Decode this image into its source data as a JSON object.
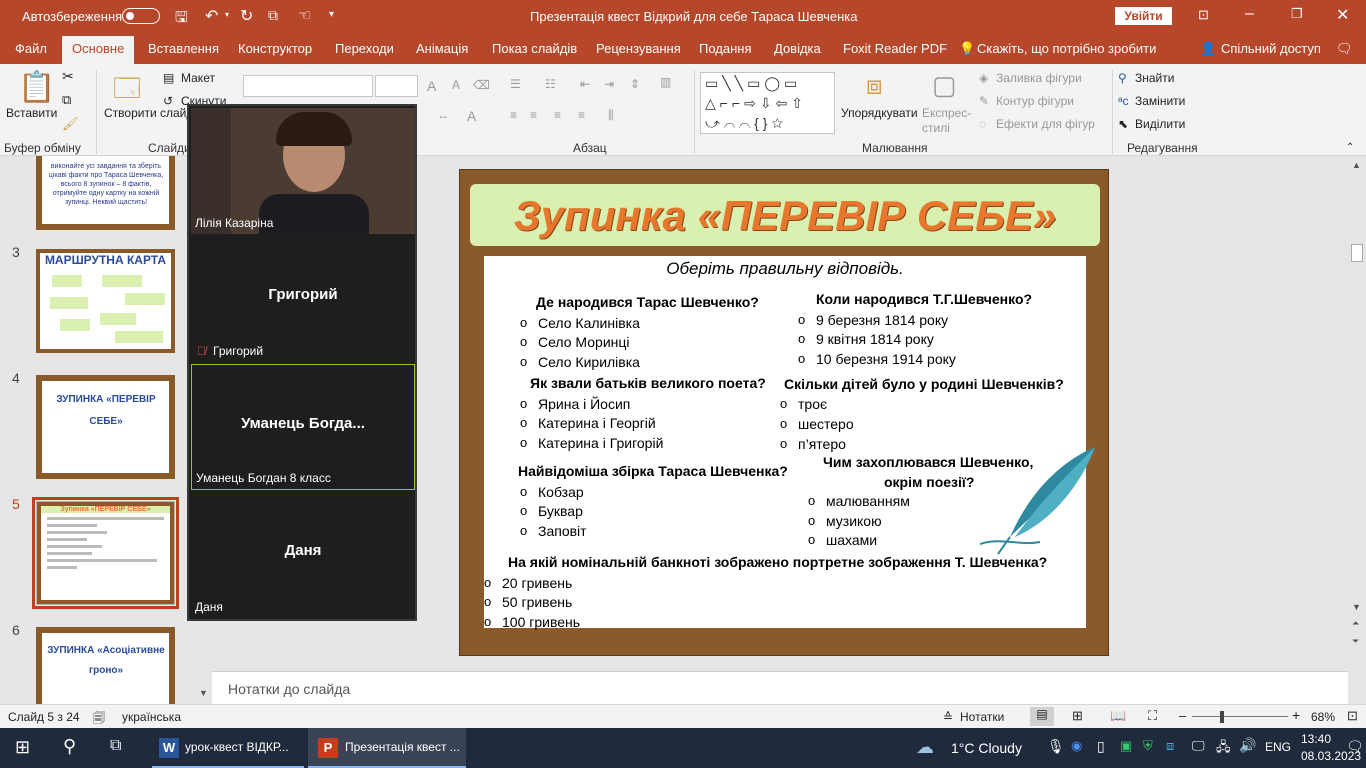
{
  "titlebar": {
    "autosave_label": "Автозбереження",
    "autosave_state": "off",
    "title": "Презентація квест Відкрий для себе Тараса Шевченка",
    "signin_label": "Увійти",
    "icons": [
      "save-icon",
      "undo-icon",
      "redo-icon",
      "present-icon",
      "touch-icon",
      "customize-icon"
    ]
  },
  "menu": {
    "tabs": [
      "Файл",
      "Основне",
      "Вставлення",
      "Конструктор",
      "Переходи",
      "Анімація",
      "Показ слайдів",
      "Рецензування",
      "Подання",
      "Довідка",
      "Foxit Reader PDF"
    ],
    "active_tab": "Основне",
    "tell_me": "Скажіть, що потрібно зробити",
    "share": "Спільний доступ"
  },
  "ribbon": {
    "paste": "Вставити",
    "clipboard_group": "Буфер обміну",
    "new_slide": "Створити слайд",
    "layout": "Макет",
    "reset": "Скинути",
    "slides_group": "Слайди",
    "paragraph_group": "Абзац",
    "arrange": "Упорядкувати",
    "quick_styles": "Експрес-стилі",
    "shape_fill": "Заливка фігури",
    "shape_outline": "Контур фігури",
    "shape_effects": "Ефекти для фігур",
    "drawing_group": "Малювання",
    "find": "Знайти",
    "replace": "Замінити",
    "select": "Виділити",
    "editing_group": "Редагування"
  },
  "thumbnails": [
    {
      "num": "",
      "caption": "виконайте усі завдання та зберіть цікаві факти про Тараса Шевченка, всього 8 зупинок – 8 фактів, отримуйте одну картку на кожній зупинці. Неквий щастить!"
    },
    {
      "num": "3",
      "caption": "МАРШРУТНА КАРТА"
    },
    {
      "num": "4",
      "caption": "ЗУПИНКА «ПЕРЕВІР СЕБЕ»"
    },
    {
      "num": "5",
      "caption": "Зупинка «ПЕРЕВІР СЕБЕ»"
    },
    {
      "num": "6",
      "caption": "ЗУПИНКА «Асоціативне гроно»"
    }
  ],
  "selected_thumbnail": "5",
  "zoom_panel": {
    "participants": [
      {
        "name": "Лілія Казаріна",
        "video": true
      },
      {
        "name": "Григорий",
        "display": "Григорий",
        "muted": true
      },
      {
        "name": "Уманець Богдан 8 класс",
        "display": "Уманець  Богда...",
        "active_speaker": true
      },
      {
        "name": "Даня",
        "display": "Даня"
      }
    ]
  },
  "slide": {
    "title": "Зупинка «ПЕРЕВІР СЕБЕ»",
    "subtitle": "Оберіть правильну відповідь.",
    "questions": [
      {
        "q": "Де народився Тарас Шевченко?",
        "options": [
          "Село Калинівка",
          "Село Моринці",
          "Село Кирилівка"
        ]
      },
      {
        "q": "Коли народився Т.Г.Шевченко?",
        "options": [
          "9 березня 1814 року",
          "9 квітня 1814 року",
          "10 березня 1914 року"
        ]
      },
      {
        "q": "Як звали батьків великого поета?",
        "options": [
          "Ярина і Йосип",
          "Катерина і Георгій",
          "Катерина і Григорій"
        ]
      },
      {
        "q": "Скільки дітей було у родині Шевченків?",
        "options": [
          "троє",
          "шестеро",
          "п’ятеро"
        ]
      },
      {
        "q": "Найвідоміша збірка Тараса Шевченка?",
        "options": [
          "Кобзар",
          "Буквар",
          "Заповіт"
        ]
      },
      {
        "q": "Чим захоплювався Шевченко, окрім поезії?",
        "q1": "Чим захоплювався Шевченко,",
        "q2": "окрім поезії?",
        "options": [
          "малюванням",
          "музикою",
          "шахами"
        ]
      },
      {
        "q": "На якій номінальній банкноті зображено портретне зображення Т. Шевченка?",
        "options": [
          "20 гривень",
          "50 гривень",
          "100 гривень"
        ]
      }
    ]
  },
  "notes_placeholder": "Нотатки до слайда",
  "status": {
    "slide_info": "Слайд 5 з 24",
    "language": "українська",
    "notes_btn": "Нотатки",
    "zoom": "68%"
  },
  "taskbar": {
    "apps": [
      {
        "label": "урок-квест ВІДКР...",
        "icon": "word-icon"
      },
      {
        "label": "Презентація квест ...",
        "icon": "powerpoint-icon",
        "active": true
      }
    ],
    "weather": "1°C  Cloudy",
    "lang": "ENG",
    "time": "13:40",
    "date": "08.03.2023"
  },
  "colors": {
    "accent": "#b7472a",
    "slide_title": "#e8772e",
    "wood": "#8b5a2b",
    "selected_thumb": "#c43e1c"
  }
}
